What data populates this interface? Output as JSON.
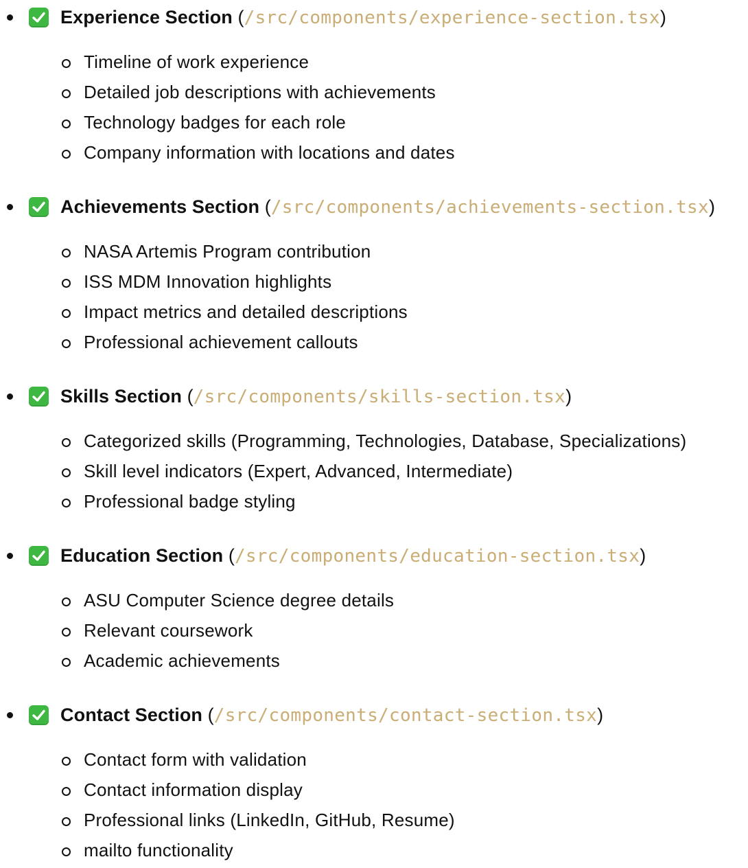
{
  "sections": [
    {
      "title": "Experience Section",
      "open_paren": "(",
      "path": "/src/components/experience-section.tsx",
      "close_paren": ")",
      "items": [
        "Timeline of work experience",
        "Detailed job descriptions with achievements",
        "Technology badges for each role",
        "Company information with locations and dates"
      ]
    },
    {
      "title": "Achievements Section",
      "open_paren": "(",
      "path": "/src/components/achievements-section.tsx",
      "close_paren": ")",
      "items": [
        "NASA Artemis Program contribution",
        "ISS MDM Innovation highlights",
        "Impact metrics and detailed descriptions",
        "Professional achievement callouts"
      ]
    },
    {
      "title": "Skills Section",
      "open_paren": "(",
      "path": "/src/components/skills-section.tsx",
      "close_paren": ")",
      "items": [
        "Categorized skills (Programming, Technologies, Database, Specializations)",
        "Skill level indicators (Expert, Advanced, Intermediate)",
        "Professional badge styling"
      ]
    },
    {
      "title": "Education Section",
      "open_paren": "(",
      "path": "/src/components/education-section.tsx",
      "close_paren": ")",
      "items": [
        "ASU Computer Science degree details",
        "Relevant coursework",
        "Academic achievements"
      ]
    },
    {
      "title": "Contact Section",
      "open_paren": "(",
      "path": "/src/components/contact-section.tsx",
      "close_paren": ")",
      "items": [
        "Contact form with validation",
        "Contact information display",
        "Professional links (LinkedIn, GitHub, Resume)",
        "mailto functionality"
      ]
    }
  ],
  "colors": {
    "path": "#c9ad75",
    "check": "#3fb743",
    "text": "#111111"
  },
  "icons": {
    "section_marker": "check-mark-button-icon",
    "bullet": "filled-disc-bullet-icon",
    "sub_bullet": "hollow-circle-bullet-icon"
  }
}
